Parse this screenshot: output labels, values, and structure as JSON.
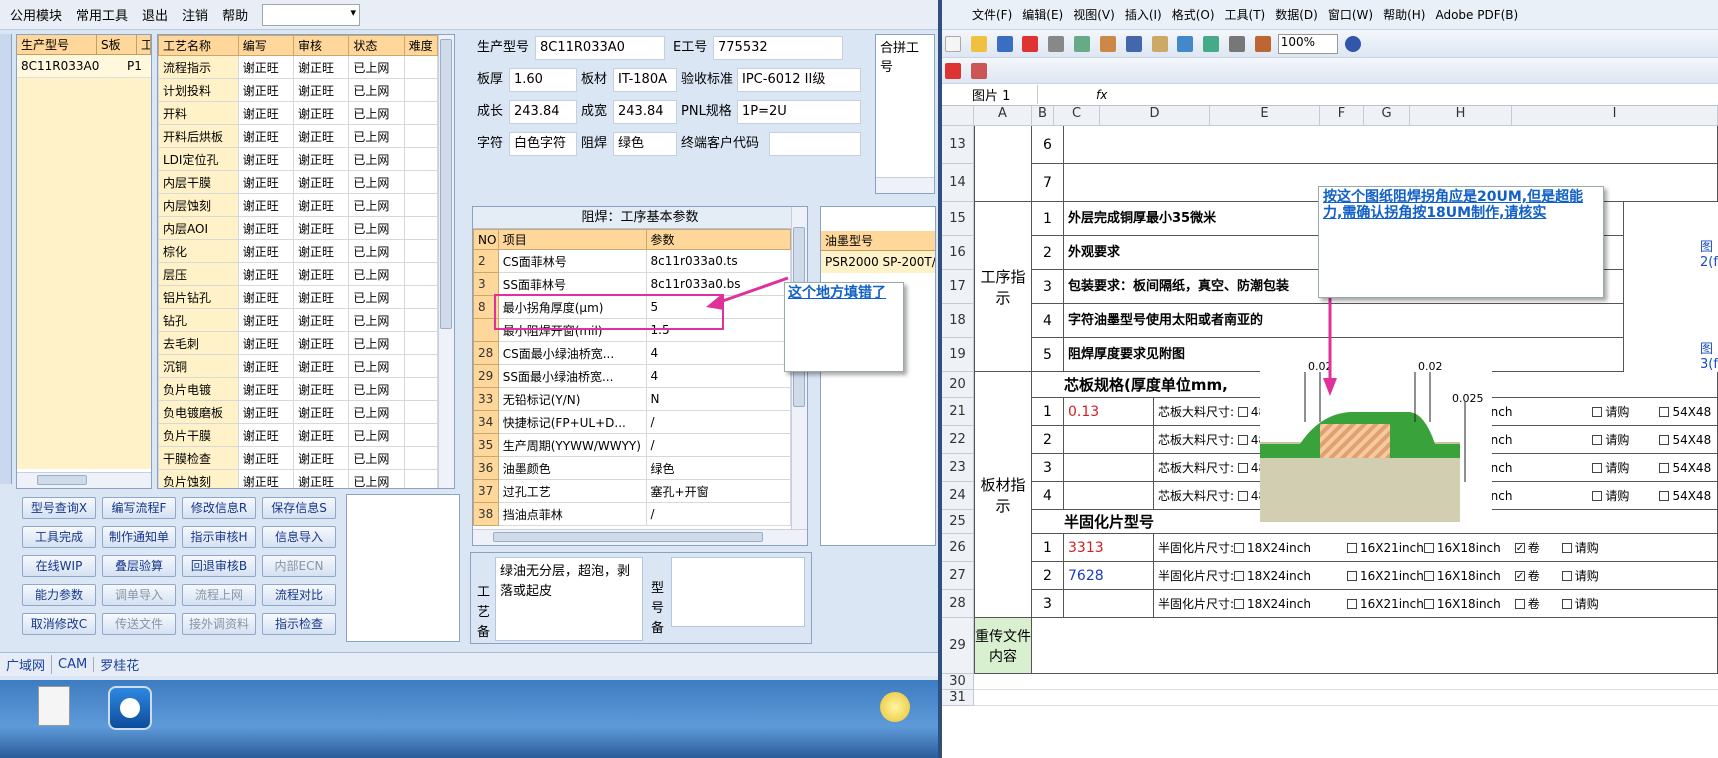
{
  "menu": {
    "items": [
      "公用模块",
      "常用工具",
      "退出",
      "注销",
      "帮助"
    ]
  },
  "models": {
    "headers": [
      "生产型号",
      "S板",
      "工"
    ],
    "row": [
      "8C11R033A0",
      "P1"
    ]
  },
  "process": {
    "headers": [
      "工艺名称",
      "编写",
      "审核",
      "状态",
      "难度"
    ],
    "rows": [
      [
        "流程指示",
        "谢正旺",
        "谢正旺",
        "已上网"
      ],
      [
        "计划投料",
        "谢正旺",
        "谢正旺",
        "已上网"
      ],
      [
        "开料",
        "谢正旺",
        "谢正旺",
        "已上网"
      ],
      [
        "开料后烘板",
        "谢正旺",
        "谢正旺",
        "已上网"
      ],
      [
        "LDI定位孔",
        "谢正旺",
        "谢正旺",
        "已上网"
      ],
      [
        "内层干膜",
        "谢正旺",
        "谢正旺",
        "已上网"
      ],
      [
        "内层蚀刻",
        "谢正旺",
        "谢正旺",
        "已上网"
      ],
      [
        "内层AOI",
        "谢正旺",
        "谢正旺",
        "已上网"
      ],
      [
        "棕化",
        "谢正旺",
        "谢正旺",
        "已上网"
      ],
      [
        "层压",
        "谢正旺",
        "谢正旺",
        "已上网"
      ],
      [
        "铝片钻孔",
        "谢正旺",
        "谢正旺",
        "已上网"
      ],
      [
        "钻孔",
        "谢正旺",
        "谢正旺",
        "已上网"
      ],
      [
        "去毛刺",
        "谢正旺",
        "谢正旺",
        "已上网"
      ],
      [
        "沉铜",
        "谢正旺",
        "谢正旺",
        "已上网"
      ],
      [
        "负片电镀",
        "谢正旺",
        "谢正旺",
        "已上网"
      ],
      [
        "负电镀磨板",
        "谢正旺",
        "谢正旺",
        "已上网"
      ],
      [
        "负片干膜",
        "谢正旺",
        "谢正旺",
        "已上网"
      ],
      [
        "干膜检查",
        "谢正旺",
        "谢正旺",
        "已上网"
      ],
      [
        "负片蚀刻",
        "谢正旺",
        "谢正旺",
        "已上网"
      ]
    ]
  },
  "info": {
    "model_label": "生产型号",
    "model": "8C11R033A0",
    "eno_label": "E工号",
    "eno": "775532",
    "thick_label": "板厚",
    "thick": "1.60",
    "mat_label": "板材",
    "mat": "IT-180A",
    "std_label": "验收标准",
    "std": "IPC-6012 II级",
    "len_label": "成长",
    "len": "243.84",
    "wid_label": "成宽",
    "wid": "243.84",
    "pnl_label": "PNL规格",
    "pnl": "1P=2U",
    "char_label": "字符",
    "char": "白色字符",
    "mask_label": "阻焊",
    "mask": "绿色",
    "cust_label": "终端客户代码",
    "merge_label": "合拼工号"
  },
  "params": {
    "title": "阻焊：工序基本参数",
    "headers": [
      "NO",
      "项目",
      "参数"
    ],
    "rows": [
      [
        "2",
        "CS面菲林号",
        "8c11r033a0.ts"
      ],
      [
        "3",
        "SS面菲林号",
        "8c11r033a0.bs"
      ],
      [
        "8",
        "最小拐角厚度(μm)",
        "5"
      ],
      [
        "",
        "最小阻焊开窗(mil)",
        "1.5"
      ],
      [
        "28",
        "CS面最小绿油桥宽...",
        "4"
      ],
      [
        "29",
        "SS面最小绿油桥宽...",
        "4"
      ],
      [
        "33",
        "无铅标记(Y/N)",
        "N"
      ],
      [
        "34",
        "快捷标记(FP+UL+D...",
        "/"
      ],
      [
        "35",
        "生产周期(YYWW/WWYY)",
        "/"
      ],
      [
        "36",
        "油墨颜色",
        "绿色"
      ],
      [
        "37",
        "过孔工艺",
        "塞孔+开窗"
      ],
      [
        "38",
        "挡油点菲林",
        "/"
      ]
    ]
  },
  "ink": {
    "header": "油墨型号",
    "value": "PSR2000 SP-200T/"
  },
  "note": {
    "side": "工艺备",
    "text": "绿油无分层，超泡，剥落或起皮",
    "side2": "型号备"
  },
  "callout_left": "这个地方填错了",
  "buttons": [
    [
      "型号查询X",
      "编写流程F",
      "修改信息R",
      "保存信息S"
    ],
    [
      "工具完成",
      "制作通知单",
      "指示审核H",
      "信息导入"
    ],
    [
      "在线WIP",
      "叠层验算",
      "回退审核B",
      "内部ECN"
    ],
    [
      "能力参数",
      "调单导入",
      "流程上网",
      "流程对比"
    ],
    [
      "取消修改C",
      "传送文件",
      "接外调资料",
      "指示检查"
    ]
  ],
  "tabs": [
    "广域网",
    "CAM",
    "罗桂花"
  ],
  "excel": {
    "menu": [
      "文件(F)",
      "编辑(E)",
      "视图(V)",
      "插入(I)",
      "格式(O)",
      "工具(T)",
      "数据(D)",
      "窗口(W)",
      "帮助(H)",
      "Adobe PDF(B)"
    ],
    "zoom": "100%",
    "namebox": "图片 1",
    "fx": "fx",
    "cols": [
      "A",
      "B",
      "C",
      "D",
      "E",
      "F",
      "G",
      "H",
      "I"
    ],
    "rows": [
      "13",
      "14",
      "15",
      "16",
      "17",
      "18",
      "19",
      "20",
      "21",
      "22",
      "23",
      "24",
      "25",
      "26",
      "27",
      "28",
      "29",
      "30",
      "31"
    ],
    "sect1": "工序指示",
    "sect2": "板材指示",
    "sect3": "重传文件内容",
    "items": [
      [
        "6",
        ""
      ],
      [
        "7",
        ""
      ],
      [
        "1",
        "外层完成铜厚最小35微米"
      ],
      [
        "2",
        "外观要求"
      ],
      [
        "3",
        "包装要求：板间隔纸，真空、防潮包装"
      ],
      [
        "4",
        "字符油墨型号使用太阳或者南亚的"
      ],
      [
        "5",
        "阻焊厚度要求见附图"
      ]
    ],
    "core_title": "芯板规格(厚度单位mm,",
    "core_rows": [
      [
        "1",
        "0.13"
      ],
      [
        "2",
        ""
      ],
      [
        "3",
        ""
      ],
      [
        "4",
        ""
      ]
    ],
    "core_label": "芯板大料尺寸:",
    "core_opts": [
      "48X36inch",
      "48X42inch",
      "18X24inch"
    ],
    "half_title": "半固化片型号",
    "half_rows": [
      [
        "1",
        "3313"
      ],
      [
        "2",
        "7628"
      ],
      [
        "3",
        ""
      ]
    ],
    "half_label": "半固化片尺寸:",
    "half_opts": [
      "18X24inch",
      "16X21inch",
      "16X18inch",
      "卷"
    ],
    "buy": "请购",
    "size54": "54X48",
    "side_links": [
      "图2(f",
      "图3(f"
    ],
    "dims": [
      "0.02",
      "0.02",
      "0.025"
    ],
    "callout": "按这个图纸阻焊拐角应是20UM,但是超能力,需确认拐角按18UM制作,请核实"
  }
}
